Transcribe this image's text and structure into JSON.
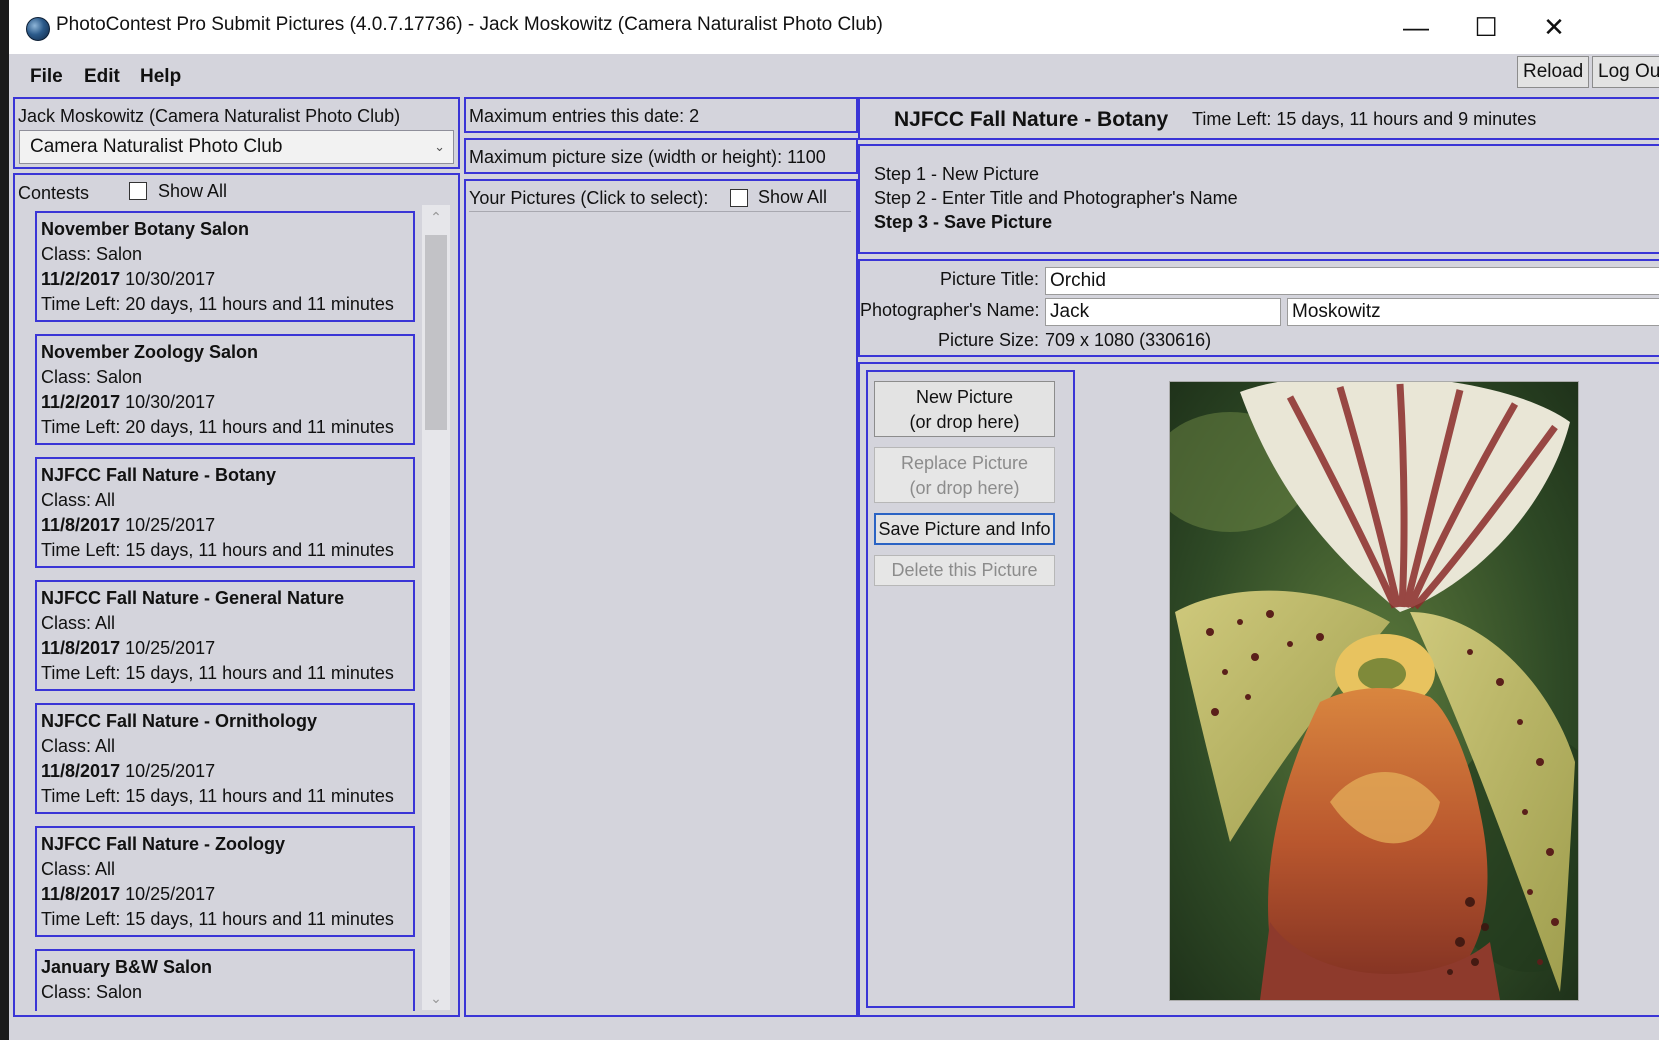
{
  "window": {
    "title": "PhotoContest Pro Submit Pictures (4.0.7.17736) -  Jack Moskowitz (Camera Naturalist Photo Club)",
    "controls": {
      "minimize": "—",
      "maximize": "☐",
      "close": "✕"
    }
  },
  "menu": {
    "file": "File",
    "edit": "Edit",
    "help": "Help"
  },
  "toolbar": {
    "reload": "Reload",
    "logout": "Log Out"
  },
  "account": {
    "user_label": "Jack Moskowitz (Camera Naturalist Photo Club)",
    "club_selected": "Camera Naturalist Photo Club"
  },
  "contests": {
    "label": "Contests",
    "show_all": "Show All",
    "show_all_checked": false,
    "items": [
      {
        "name": "November Botany Salon",
        "class": "Class: Salon",
        "date1": "11/2/2017",
        "date2": "10/30/2017",
        "time_left": "Time Left: 20 days, 11 hours and 11 minutes"
      },
      {
        "name": "November Zoology Salon",
        "class": "Class: Salon",
        "date1": "11/2/2017",
        "date2": "10/30/2017",
        "time_left": "Time Left: 20 days, 11 hours and 11 minutes"
      },
      {
        "name": "NJFCC Fall Nature - Botany",
        "class": "Class: All",
        "date1": "11/8/2017",
        "date2": "10/25/2017",
        "time_left": "Time Left: 15 days, 11 hours and 11 minutes"
      },
      {
        "name": "NJFCC Fall Nature - General Nature",
        "class": "Class: All",
        "date1": "11/8/2017",
        "date2": "10/25/2017",
        "time_left": "Time Left: 15 days, 11 hours and 11 minutes"
      },
      {
        "name": "NJFCC Fall Nature - Ornithology",
        "class": "Class: All",
        "date1": "11/8/2017",
        "date2": "10/25/2017",
        "time_left": "Time Left: 15 days, 11 hours and 11 minutes"
      },
      {
        "name": "NJFCC Fall Nature - Zoology",
        "class": "Class: All",
        "date1": "11/8/2017",
        "date2": "10/25/2017",
        "time_left": "Time Left: 15 days, 11 hours and 11 minutes"
      },
      {
        "name": "January B&W Salon",
        "class": "Class: Salon"
      }
    ]
  },
  "limits": {
    "max_entries": "Maximum entries this date: 2",
    "max_size": "Maximum picture size (width or height): 1100"
  },
  "pictures": {
    "label": "Your Pictures (Click to select):",
    "show_all": "Show All"
  },
  "contest_header": {
    "name": "NJFCC Fall Nature - Botany",
    "time_left": "Time Left: 15 days, 11 hours and 9 minutes"
  },
  "steps": {
    "step1": "Step 1 - New Picture",
    "step2": "Step 2 - Enter Title and Photographer's Name",
    "step3": "Step 3 - Save Picture"
  },
  "form": {
    "title_label": "Picture Title:",
    "title_value": "Orchid",
    "photographer_label": "Photographer's Name:",
    "first_name": "Jack",
    "last_name": "Moskowitz",
    "size_label": "Picture Size:",
    "size_value": "709 x 1080 (330616)"
  },
  "actions": {
    "new_picture": [
      "New Picture",
      "(or drop here)"
    ],
    "replace_picture": [
      "Replace Picture",
      "(or drop here)"
    ],
    "save": "Save Picture and Info",
    "delete": "Delete this Picture"
  },
  "preview": {
    "subject": "orchid-photo"
  }
}
